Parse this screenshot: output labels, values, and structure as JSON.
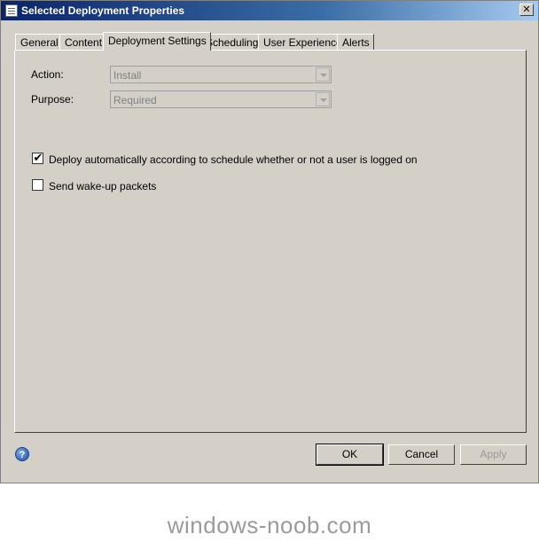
{
  "window": {
    "title": "Selected Deployment Properties"
  },
  "tabs": [
    {
      "label": "General"
    },
    {
      "label": "Content"
    },
    {
      "label": "Deployment Settings"
    },
    {
      "label": "Scheduling"
    },
    {
      "label": "User Experience"
    },
    {
      "label": "Alerts"
    }
  ],
  "active_tab": "Deployment Settings",
  "form": {
    "action": {
      "label": "Action:",
      "value": "Install"
    },
    "purpose": {
      "label": "Purpose:",
      "value": "Required"
    },
    "deploy_auto": {
      "label": "Deploy automatically according to schedule whether or not a user is logged on",
      "checked": true,
      "mark": "✔"
    },
    "wake_up": {
      "label": "Send wake-up packets",
      "checked": false
    }
  },
  "buttons": {
    "ok": "OK",
    "cancel": "Cancel",
    "apply": "Apply"
  },
  "help_glyph": "?",
  "close_glyph": "✕",
  "watermark": "windows-noob.com"
}
